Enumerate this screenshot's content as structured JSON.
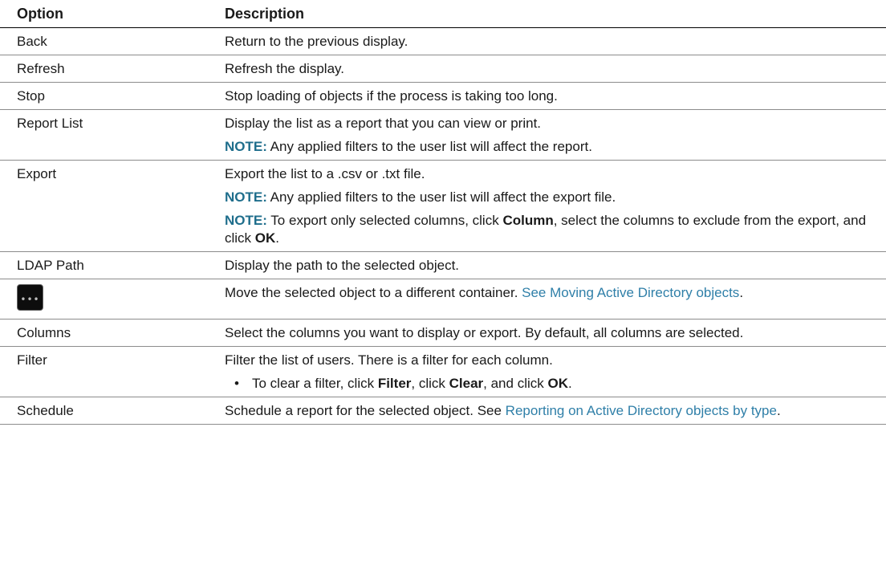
{
  "table": {
    "headers": {
      "option": "Option",
      "description": "Description"
    },
    "rows": [
      {
        "option": "Back",
        "desc": "Return to the previous display."
      },
      {
        "option": "Refresh",
        "desc": "Refresh the display."
      },
      {
        "option": "Stop",
        "desc": "Stop loading of objects if the process is taking too long."
      },
      {
        "option": "Report List",
        "desc": "Display the list as a report that you can view or print.",
        "note_label": "NOTE:",
        "note_text": " Any applied filters to the user list will affect the report."
      },
      {
        "option": "Export",
        "desc": "Export the list to a .csv or .txt file.",
        "note1_label": "NOTE:",
        "note1_text": " Any applied filters to the user list will affect the export file.",
        "note2_label": "NOTE:",
        "note2_text_a": " To export only selected columns, click ",
        "note2_bold_column": "Column",
        "note2_text_b": ", select the columns to exclude from the export, and click ",
        "note2_bold_ok": "OK",
        "note2_text_c": "."
      },
      {
        "option": "LDAP Path",
        "desc": "Display the path to the selected object."
      },
      {
        "option_icon": "ellipsis-button-icon",
        "option_icon_text": "•••",
        "desc": "Move the selected object to a different container. ",
        "link": "See Moving Active Directory objects",
        "desc_tail": "."
      },
      {
        "option": "Columns",
        "desc": "Select the columns you want to display or export. By default, all columns are selected."
      },
      {
        "option": "Filter",
        "desc": "Filter the list of users. There is a filter for each column.",
        "bullet": "•",
        "bullet_text_a": "To clear a filter, click ",
        "bullet_bold_filter": "Filter",
        "bullet_text_b": ", click ",
        "bullet_bold_clear": "Clear",
        "bullet_text_c": ", and click ",
        "bullet_bold_ok": "OK",
        "bullet_text_d": "."
      },
      {
        "option": "Schedule",
        "desc": "Schedule a report for the selected object. See ",
        "link": "Reporting on Active Directory objects by type",
        "desc_tail": "."
      }
    ]
  },
  "colors": {
    "note_label": "#1f6e8c",
    "link": "#2f7fa8",
    "text": "#1a1a1a"
  }
}
